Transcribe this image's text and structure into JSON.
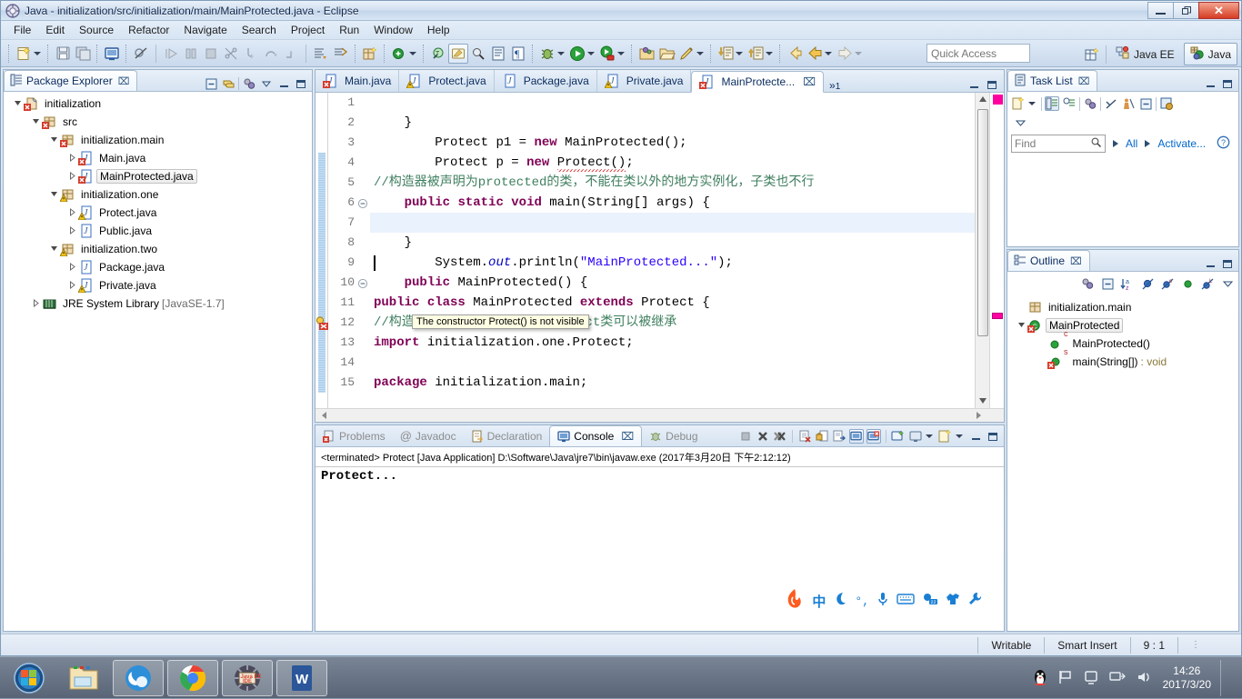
{
  "window": {
    "title": "Java - initialization/src/initialization/main/MainProtected.java - Eclipse",
    "app_icon": "eclipse-icon",
    "controls": {
      "minimize": "–",
      "restore": "❐",
      "close": "✕"
    }
  },
  "menubar": {
    "items": [
      "File",
      "Edit",
      "Source",
      "Refactor",
      "Navigate",
      "Search",
      "Project",
      "Run",
      "Window",
      "Help"
    ]
  },
  "toolbar": {
    "quick_access_placeholder": "Quick Access",
    "perspectives": [
      {
        "label": "Java EE",
        "active": false,
        "icon": "javaee-perspective-icon"
      },
      {
        "label": "Java",
        "active": true,
        "icon": "java-perspective-icon"
      }
    ],
    "groups": [
      [
        "new-wizard-icon",
        "new-wizard-dropdown"
      ],
      [
        "save-icon",
        "save-all-icon"
      ],
      [
        "print-icon"
      ],
      [
        "toggle-breakpoint-icon"
      ],
      [
        "resume-icon",
        "suspend-icon",
        "terminate-icon",
        "disconnect-icon",
        "step-into-icon",
        "step-over-icon",
        "step-return-icon"
      ],
      [
        "next-annotation-icon",
        "previous-annotation-icon"
      ],
      [
        "new-java-package-icon"
      ],
      [
        "new-java-class-icon",
        "new-java-class-dropdown"
      ],
      [
        "open-type-icon",
        "search-icon"
      ],
      [
        "external-tools-icon",
        "pilcrow-icon"
      ],
      [
        "debug-icon",
        "debug-dropdown",
        "run-icon",
        "run-dropdown",
        "run-external-icon",
        "run-external-dropdown"
      ],
      [
        "open-package-icon",
        "open-folder-icon",
        "paint-icon",
        "paint-dropdown"
      ],
      [
        "import-icon",
        "import-dropdown",
        "export-icon",
        "export-dropdown"
      ],
      [
        "back-history-icon",
        "back-icon",
        "back-dropdown",
        "forward-icon",
        "forward-dropdown"
      ]
    ]
  },
  "package_explorer": {
    "title": "Package Explorer",
    "close_label": "⌧",
    "tools": [
      "collapse-all-icon",
      "link-with-editor-icon",
      "view-menu-icon",
      "minimize-icon",
      "maximize-icon"
    ],
    "tree": [
      {
        "label": "initialization",
        "indent": 0,
        "twisty": "open",
        "icon": "java-project-error-icon",
        "selected": false
      },
      {
        "label": "src",
        "indent": 1,
        "twisty": "open",
        "icon": "source-folder-error-icon",
        "selected": false
      },
      {
        "label": "initialization.main",
        "indent": 2,
        "twisty": "open",
        "icon": "package-error-icon",
        "selected": false
      },
      {
        "label": "Main.java",
        "indent": 3,
        "twisty": "closed",
        "icon": "java-file-error-icon",
        "selected": false
      },
      {
        "label": "MainProtected.java",
        "indent": 3,
        "twisty": "closed",
        "icon": "java-file-error-icon",
        "selected": true
      },
      {
        "label": "initialization.one",
        "indent": 2,
        "twisty": "open",
        "icon": "package-warning-icon",
        "selected": false
      },
      {
        "label": "Protect.java",
        "indent": 3,
        "twisty": "closed",
        "icon": "java-file-warning-icon",
        "selected": false
      },
      {
        "label": "Public.java",
        "indent": 3,
        "twisty": "closed",
        "icon": "java-file-icon",
        "selected": false
      },
      {
        "label": "initialization.two",
        "indent": 2,
        "twisty": "open",
        "icon": "package-warning-icon",
        "selected": false
      },
      {
        "label": "Package.java",
        "indent": 3,
        "twisty": "closed",
        "icon": "java-file-icon",
        "selected": false
      },
      {
        "label": "Private.java",
        "indent": 3,
        "twisty": "closed",
        "icon": "java-file-warning-icon",
        "selected": false
      },
      {
        "label": "JRE System Library",
        "suffix": " [JavaSE-1.7]",
        "indent": 1,
        "twisty": "closed",
        "icon": "library-icon",
        "selected": false
      }
    ]
  },
  "editor": {
    "tabs": [
      {
        "label": "Main.java",
        "icon": "java-file-error-icon",
        "active": false
      },
      {
        "label": "Protect.java",
        "icon": "java-file-warning-icon",
        "active": false
      },
      {
        "label": "Package.java",
        "icon": "java-file-icon",
        "active": false
      },
      {
        "label": "Private.java",
        "icon": "java-file-warning-icon",
        "active": false
      },
      {
        "label": "MainProtecte...",
        "icon": "java-file-error-icon",
        "active": true,
        "close_label": "⌧"
      }
    ],
    "overflow_label": "»",
    "overflow_count": "1",
    "tools": [
      "minimize-icon",
      "maximize-icon"
    ],
    "tooltip": "The constructor Protect() is not visible",
    "lines": [
      {
        "n": "1",
        "fold": "",
        "marker": "",
        "current": false
      },
      {
        "n": "2",
        "fold": "",
        "marker": "",
        "current": false
      },
      {
        "n": "3",
        "fold": "",
        "marker": "",
        "current": false
      },
      {
        "n": "4",
        "fold": "",
        "marker": "",
        "current": false
      },
      {
        "n": "5",
        "fold": "",
        "marker": "",
        "current": false
      },
      {
        "n": "6",
        "fold": "collapse",
        "marker": "",
        "current": false
      },
      {
        "n": "7",
        "fold": "",
        "marker": "",
        "current": false
      },
      {
        "n": "8",
        "fold": "",
        "marker": "",
        "current": false
      },
      {
        "n": "9",
        "fold": "",
        "marker": "",
        "current": true
      },
      {
        "n": "10",
        "fold": "collapse",
        "marker": "",
        "current": false
      },
      {
        "n": "11",
        "fold": "",
        "marker": "",
        "current": false
      },
      {
        "n": "12",
        "fold": "",
        "marker": "error-quickfix",
        "current": false
      },
      {
        "n": "13",
        "fold": "",
        "marker": "",
        "current": false
      },
      {
        "n": "14",
        "fold": "",
        "marker": "",
        "current": false
      },
      {
        "n": "15",
        "fold": "",
        "marker": "",
        "current": false
      }
    ],
    "code_text": [
      "package initialization.main;",
      "",
      "import initialization.one.Protect;",
      "//构造器声明为protected的Protect类可以被继承",
      "public class MainProtected extends Protect {",
      "    public MainProtected() {",
      "        System.out.println(\"MainProtected...\");",
      "    }",
      "",
      "    public static void main(String[] args) {",
      "//构造器被声明为protected的类，不能在类以外的地方实例化，子类也不行",
      "        Protect p = new Protect();",
      "        Protect p1 = new MainProtected();",
      "    }",
      ""
    ]
  },
  "console": {
    "tabs": [
      {
        "label": "Problems",
        "icon": "problems-icon",
        "active": false
      },
      {
        "label": "Javadoc",
        "icon": "javadoc-icon",
        "active": false
      },
      {
        "label": "Declaration",
        "icon": "declaration-icon",
        "active": false
      },
      {
        "label": "Console",
        "icon": "console-icon",
        "active": true,
        "close_label": "⌧"
      },
      {
        "label": "Debug",
        "icon": "debug-icon",
        "active": false
      }
    ],
    "tools": [
      "terminate-icon",
      "remove-launch-icon",
      "remove-all-launches-icon",
      "clear-console-icon",
      "scroll-lock-icon",
      "pin-console-icon",
      "display-selected-console-icon",
      "close-console-icon",
      "open-console-icon",
      "new-console-view-icon",
      "view-menu-icon",
      "minimize-icon",
      "maximize-icon"
    ],
    "launch_header": "<terminated> Protect [Java Application] D:\\Software\\Java\\jre7\\bin\\javaw.exe (2017年3月20日 下午2:12:12)",
    "output": [
      "Protect..."
    ],
    "ime_bar": {
      "logo": "sogou-logo-icon",
      "items": [
        "中",
        "moon-icon",
        "degree-comma-icon",
        "microphone-icon",
        "keyboard-icon",
        "expression-icon",
        "skin-icon",
        "toolbox-icon"
      ]
    }
  },
  "task_list": {
    "title": "Task List",
    "close_label": "⌧",
    "tools": [
      "new-task-icon",
      "new-task-dropdown",
      "categorized-presentation-icon",
      "scheduled-presentation-icon",
      "synchronize-changed-icon",
      "focus-on-workweek-icon",
      "collapse-all-icon",
      "restore-tasks-icon",
      "view-menu-icon"
    ],
    "find_placeholder": "Find",
    "search_icon": "search-icon",
    "filter_all": "All",
    "filter_activate": "Activate...",
    "help_icon": "help-icon"
  },
  "outline": {
    "title": "Outline",
    "close_label": "⌧",
    "tools": [
      "focus-on-active-task-icon",
      "collapse-all-icon",
      "sort-icon",
      "hide-fields-icon",
      "hide-static-icon",
      "hide-non-public-icon",
      "hide-local-types-icon",
      "view-menu-icon"
    ],
    "tree": [
      {
        "label": "initialization.main",
        "indent": 0,
        "twisty": "",
        "icon": "package-icon",
        "selected": false
      },
      {
        "label": "MainProtected",
        "indent": 0,
        "twisty": "open",
        "icon": "class-error-icon",
        "selected": true
      },
      {
        "label": "MainProtected()",
        "indent": 1,
        "twisty": "",
        "icon": "public-constructor-icon",
        "badge": "c",
        "selected": false
      },
      {
        "label": "main(String[])",
        "suffix": " : void",
        "indent": 1,
        "twisty": "",
        "icon": "public-static-method-error-icon",
        "badge": "s",
        "selected": false
      }
    ]
  },
  "statusbar": {
    "writable": "Writable",
    "insert_mode": "Smart Insert",
    "position": "9 : 1"
  },
  "taskbar": {
    "buttons": [
      {
        "name": "start-button",
        "icon": "windows-start-icon",
        "active": false
      },
      {
        "name": "explorer-button",
        "icon": "file-explorer-icon",
        "active": false
      },
      {
        "name": "browser-button",
        "icon": "uc-browser-icon",
        "active": true
      },
      {
        "name": "chrome-button",
        "icon": "chrome-icon",
        "active": true
      },
      {
        "name": "eclipse-button",
        "icon": "java-ee-ide-icon",
        "active": true
      },
      {
        "name": "word-button",
        "icon": "word-icon",
        "active": true
      }
    ],
    "tray": [
      "qq-penguin-icon",
      "flag-icon",
      "action-center-icon",
      "network-icon",
      "volume-icon"
    ],
    "clock_time": "14:26",
    "clock_date": "2017/3/20"
  },
  "colors": {
    "keyword": "#7f0055",
    "string": "#2a00ff",
    "comment": "#3f7f5f",
    "field": "#0000c0",
    "selection": "#eaf2fd",
    "error_marker": "#ff00a0",
    "link": "#0066cc"
  }
}
